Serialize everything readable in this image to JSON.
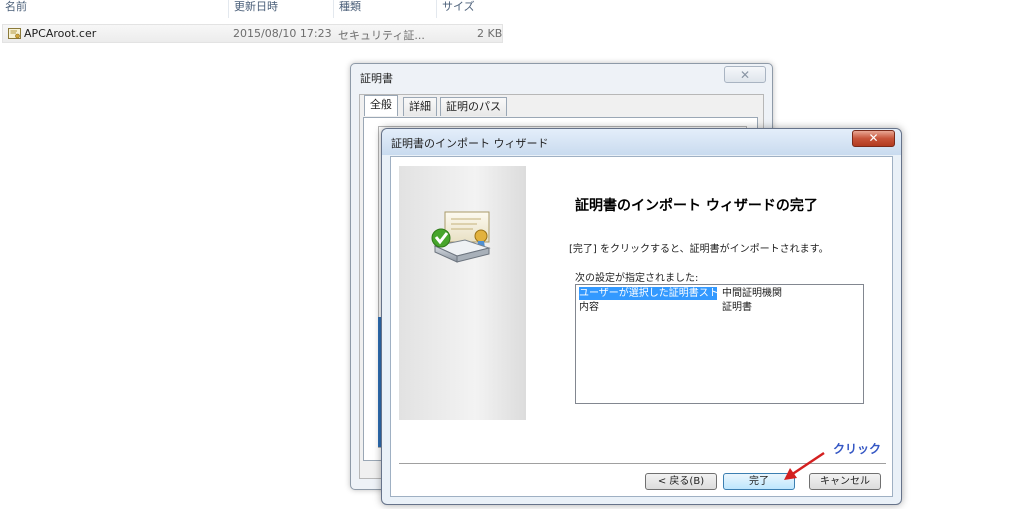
{
  "explorer": {
    "columns": {
      "name": "名前",
      "modified": "更新日時",
      "type": "種類",
      "size": "サイズ"
    },
    "file": {
      "icon": "certificate-file-icon",
      "name": "APCAroot.cer",
      "modified": "2015/08/10 17:23",
      "type": "セキュリティ証...",
      "size": "2 KB"
    }
  },
  "cert_dialog": {
    "title": "証明書",
    "close_glyph": "✕",
    "tabs": [
      "全般",
      "詳細",
      "証明のパス"
    ],
    "active_tab": "全般"
  },
  "wizard": {
    "title": "証明書のインポート ウィザード",
    "close_glyph": "✕",
    "heading": "証明書のインポート ウィザードの完了",
    "description": "[完了] をクリックすると、証明書がインポートされます。",
    "list_label": "次の設定が指定されました:",
    "settings": [
      {
        "key": "ユーザーが選択した証明書ストア",
        "value": "中間証明機関",
        "selected": true
      },
      {
        "key": "内容",
        "value": "証明書",
        "selected": false
      }
    ],
    "buttons": {
      "back": "< 戻る(B)",
      "finish": "完了",
      "cancel": "キャンセル"
    }
  },
  "annotation": {
    "label": "クリック",
    "color": "#3557c4",
    "arrow_color": "#d42020"
  }
}
